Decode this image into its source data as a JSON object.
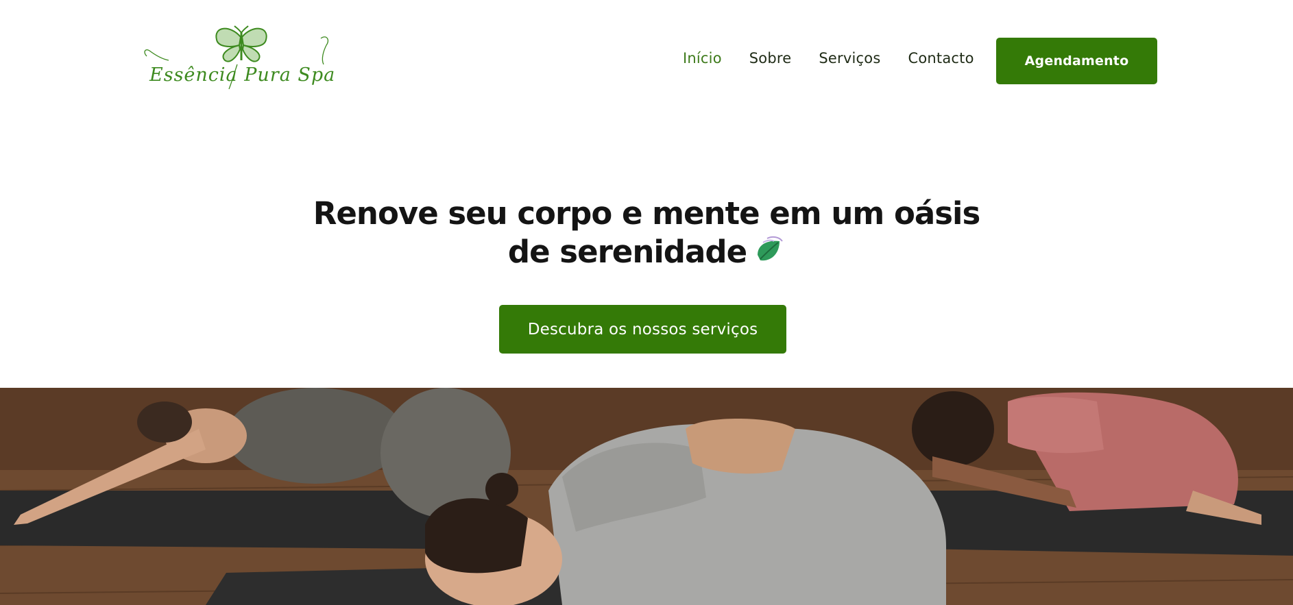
{
  "brand": {
    "logo_text": "Essência Pura Spa",
    "accent_color": "#347a07",
    "logo_color": "#3d8a1f"
  },
  "nav": {
    "items": [
      {
        "label": "Início",
        "active": true
      },
      {
        "label": "Sobre",
        "active": false
      },
      {
        "label": "Serviços",
        "active": false
      },
      {
        "label": "Contacto",
        "active": false
      }
    ],
    "cta_label": "Agendamento"
  },
  "hero": {
    "title_line1": "Renove seu corpo e mente em um oásis",
    "title_line2": "de serenidade",
    "title_icon": "leaf-icon",
    "cta_label": "Descubra os nossos serviços"
  },
  "banner": {
    "icon": "yoga-class-photo"
  }
}
